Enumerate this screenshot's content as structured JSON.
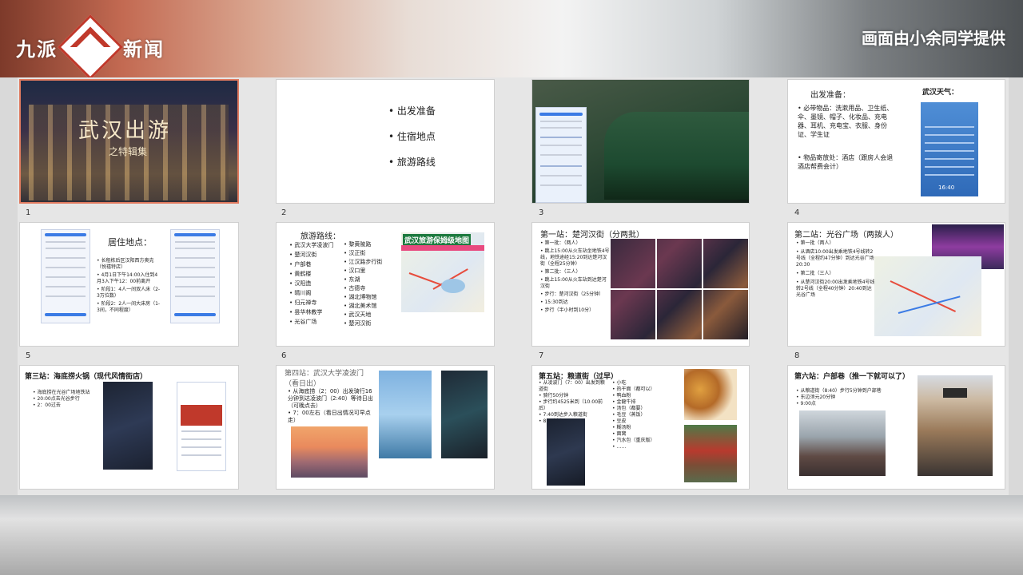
{
  "header": {
    "logo_left": "九派",
    "logo_right": "新闻",
    "credit": "画面由小余同学提供"
  },
  "slides": [
    {
      "num": "1",
      "title": "武汉出游",
      "subtitle": "之特辑集"
    },
    {
      "num": "2",
      "items": [
        "出发准备",
        "住宿地点",
        "旅游路线"
      ]
    },
    {
      "num": "3"
    },
    {
      "num": "4",
      "title": "出发准备：",
      "weather_title": "武汉天气：",
      "items": [
        "必带物品：洗漱用品、卫生纸、伞、墨镜、帽子、化妆品、充电器、耳机、充电宝、衣服、身份证、学生证",
        "物品寄放处：酒店（跟房人会退酒店帮费会计）"
      ],
      "weather_time": "16:40"
    },
    {
      "num": "5",
      "title": "居住地点：",
      "items": [
        "长租栋后区汉阳西方奥克（悦禧特店）",
        "4月1日下午14:00入住到4月3入下午12：00前离开",
        "阶段1：4人一间双人床（2-3万位数）",
        "阶段2：2人一间大床房（1-3间，不同程度）"
      ]
    },
    {
      "num": "6",
      "title": "旅游路线：",
      "col1": [
        "武汉大学凌波门",
        "楚河汉街",
        "户部巷",
        "黄鹤楼",
        "汉阳造",
        "晴川阁",
        "归元禅寺",
        "昙华林教学",
        "光谷广场"
      ],
      "col2": [
        "黎黄陂路",
        "汉正街",
        "江汉路步行街",
        "汉口里",
        "东湖",
        "古德寺",
        "湖北博物馆",
        "湖北美术馆",
        "武汉天地",
        "楚河汉街"
      ],
      "map_title": "武汉旅游保姆级地图"
    },
    {
      "num": "7",
      "title": "第一站：楚河汉街（分两批）",
      "items": [
        "第一批：（两人）",
        "跳上15:00从火车站坐地铁4号线，地铁途经15:20到达楚河汉街（全程25分钟）",
        "第二批：（三人）",
        "跳上15:00从火车站到达楚河汉街",
        "步行：楚河汉街（25分钟）",
        "15:30到达",
        "步行（半小时到10分）"
      ]
    },
    {
      "num": "8",
      "title": "第二站：光谷广场（两拨人）",
      "items": [
        "第一批（两人）",
        "从酒店10:00出发乘地铁4号线转2号线（全程约47分钟）到达光谷广场20:30",
        "第二批（三人）",
        "从楚河汉街20:00出发乘地铁4号线转2号线（全程40分钟）20:40到达光谷广场"
      ]
    },
    {
      "num": "9",
      "title": "第三站：海底捞火锅（现代风情街店）",
      "items": [
        "海底捞在光谷广场地铁站",
        "20:00点去光谷步行",
        "2：00过去"
      ]
    },
    {
      "num": "10",
      "title": "第四站：武汉大学凌波门（看日出）",
      "items": [
        "从海底捞（2：00）出发骑行16分钟到达凌波门（2:40）等待日出（可晚点去）",
        "7：00左右（看日出情况可早点走）"
      ]
    },
    {
      "num": "11",
      "title": "第五站：粮道街（过早）",
      "items": [
        "从凌波门（7：00）出发到粮道街",
        "骑行50分钟",
        "步行约4525米到（10:00前后）",
        "7:40到达步入粮道街",
        "8:40过来"
      ],
      "foods": [
        "小吃",
        "热干面（都可以）",
        "鸭血粉",
        "金龍牛排",
        "汤包（都要）",
        "毛豆（蒸饭）",
        "豆皮",
        "糊汤粉",
        "面窝",
        "汽水包（重庆版）",
        "……"
      ]
    },
    {
      "num": "12",
      "title": "第六站：户部巷（推一下就可以了）",
      "items": [
        "从粮道街（8:40）步行5分钟到户部巷",
        "东边须元20分钟",
        "9:00点"
      ]
    }
  ]
}
